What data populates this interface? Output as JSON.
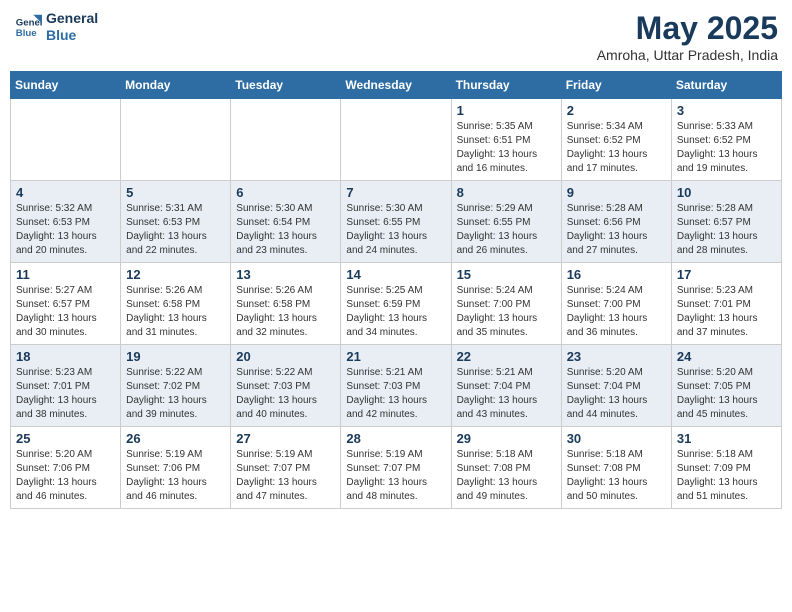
{
  "header": {
    "logo_line1": "General",
    "logo_line2": "Blue",
    "month_title": "May 2025",
    "location": "Amroha, Uttar Pradesh, India"
  },
  "days_of_week": [
    "Sunday",
    "Monday",
    "Tuesday",
    "Wednesday",
    "Thursday",
    "Friday",
    "Saturday"
  ],
  "weeks": [
    {
      "days": [
        {
          "num": "",
          "info": ""
        },
        {
          "num": "",
          "info": ""
        },
        {
          "num": "",
          "info": ""
        },
        {
          "num": "",
          "info": ""
        },
        {
          "num": "1",
          "info": "Sunrise: 5:35 AM\nSunset: 6:51 PM\nDaylight: 13 hours\nand 16 minutes."
        },
        {
          "num": "2",
          "info": "Sunrise: 5:34 AM\nSunset: 6:52 PM\nDaylight: 13 hours\nand 17 minutes."
        },
        {
          "num": "3",
          "info": "Sunrise: 5:33 AM\nSunset: 6:52 PM\nDaylight: 13 hours\nand 19 minutes."
        }
      ]
    },
    {
      "days": [
        {
          "num": "4",
          "info": "Sunrise: 5:32 AM\nSunset: 6:53 PM\nDaylight: 13 hours\nand 20 minutes."
        },
        {
          "num": "5",
          "info": "Sunrise: 5:31 AM\nSunset: 6:53 PM\nDaylight: 13 hours\nand 22 minutes."
        },
        {
          "num": "6",
          "info": "Sunrise: 5:30 AM\nSunset: 6:54 PM\nDaylight: 13 hours\nand 23 minutes."
        },
        {
          "num": "7",
          "info": "Sunrise: 5:30 AM\nSunset: 6:55 PM\nDaylight: 13 hours\nand 24 minutes."
        },
        {
          "num": "8",
          "info": "Sunrise: 5:29 AM\nSunset: 6:55 PM\nDaylight: 13 hours\nand 26 minutes."
        },
        {
          "num": "9",
          "info": "Sunrise: 5:28 AM\nSunset: 6:56 PM\nDaylight: 13 hours\nand 27 minutes."
        },
        {
          "num": "10",
          "info": "Sunrise: 5:28 AM\nSunset: 6:57 PM\nDaylight: 13 hours\nand 28 minutes."
        }
      ]
    },
    {
      "days": [
        {
          "num": "11",
          "info": "Sunrise: 5:27 AM\nSunset: 6:57 PM\nDaylight: 13 hours\nand 30 minutes."
        },
        {
          "num": "12",
          "info": "Sunrise: 5:26 AM\nSunset: 6:58 PM\nDaylight: 13 hours\nand 31 minutes."
        },
        {
          "num": "13",
          "info": "Sunrise: 5:26 AM\nSunset: 6:58 PM\nDaylight: 13 hours\nand 32 minutes."
        },
        {
          "num": "14",
          "info": "Sunrise: 5:25 AM\nSunset: 6:59 PM\nDaylight: 13 hours\nand 34 minutes."
        },
        {
          "num": "15",
          "info": "Sunrise: 5:24 AM\nSunset: 7:00 PM\nDaylight: 13 hours\nand 35 minutes."
        },
        {
          "num": "16",
          "info": "Sunrise: 5:24 AM\nSunset: 7:00 PM\nDaylight: 13 hours\nand 36 minutes."
        },
        {
          "num": "17",
          "info": "Sunrise: 5:23 AM\nSunset: 7:01 PM\nDaylight: 13 hours\nand 37 minutes."
        }
      ]
    },
    {
      "days": [
        {
          "num": "18",
          "info": "Sunrise: 5:23 AM\nSunset: 7:01 PM\nDaylight: 13 hours\nand 38 minutes."
        },
        {
          "num": "19",
          "info": "Sunrise: 5:22 AM\nSunset: 7:02 PM\nDaylight: 13 hours\nand 39 minutes."
        },
        {
          "num": "20",
          "info": "Sunrise: 5:22 AM\nSunset: 7:03 PM\nDaylight: 13 hours\nand 40 minutes."
        },
        {
          "num": "21",
          "info": "Sunrise: 5:21 AM\nSunset: 7:03 PM\nDaylight: 13 hours\nand 42 minutes."
        },
        {
          "num": "22",
          "info": "Sunrise: 5:21 AM\nSunset: 7:04 PM\nDaylight: 13 hours\nand 43 minutes."
        },
        {
          "num": "23",
          "info": "Sunrise: 5:20 AM\nSunset: 7:04 PM\nDaylight: 13 hours\nand 44 minutes."
        },
        {
          "num": "24",
          "info": "Sunrise: 5:20 AM\nSunset: 7:05 PM\nDaylight: 13 hours\nand 45 minutes."
        }
      ]
    },
    {
      "days": [
        {
          "num": "25",
          "info": "Sunrise: 5:20 AM\nSunset: 7:06 PM\nDaylight: 13 hours\nand 46 minutes."
        },
        {
          "num": "26",
          "info": "Sunrise: 5:19 AM\nSunset: 7:06 PM\nDaylight: 13 hours\nand 46 minutes."
        },
        {
          "num": "27",
          "info": "Sunrise: 5:19 AM\nSunset: 7:07 PM\nDaylight: 13 hours\nand 47 minutes."
        },
        {
          "num": "28",
          "info": "Sunrise: 5:19 AM\nSunset: 7:07 PM\nDaylight: 13 hours\nand 48 minutes."
        },
        {
          "num": "29",
          "info": "Sunrise: 5:18 AM\nSunset: 7:08 PM\nDaylight: 13 hours\nand 49 minutes."
        },
        {
          "num": "30",
          "info": "Sunrise: 5:18 AM\nSunset: 7:08 PM\nDaylight: 13 hours\nand 50 minutes."
        },
        {
          "num": "31",
          "info": "Sunrise: 5:18 AM\nSunset: 7:09 PM\nDaylight: 13 hours\nand 51 minutes."
        }
      ]
    }
  ]
}
